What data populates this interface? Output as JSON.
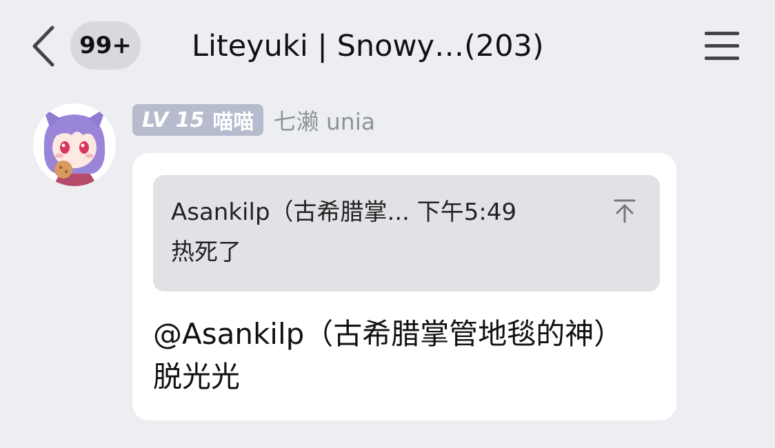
{
  "header": {
    "back_icon": "chevron-left-icon",
    "unread_count": "99+",
    "title": "Liteyuki | Snowy…(203)",
    "menu_icon": "hamburger-menu-icon"
  },
  "message": {
    "avatar_icon": "anime-avatar-icon",
    "level_prefix": "LV",
    "level_number": "15",
    "level_title": "喵喵",
    "sender_name": "七濑 unia",
    "quote": {
      "author": "Asankilp（古希腊掌...",
      "time": "下午5:49",
      "text": "热死了",
      "jump_icon": "jump-to-top-icon"
    },
    "text": "@Asankilp（古希腊掌管地毯的神） 脱光光"
  },
  "colors": {
    "background": "#eceef2",
    "bubble": "#ffffff",
    "quote_bg": "#e1e2e6",
    "level_badge": "#b6bccd",
    "muted_text": "#8f929a"
  }
}
